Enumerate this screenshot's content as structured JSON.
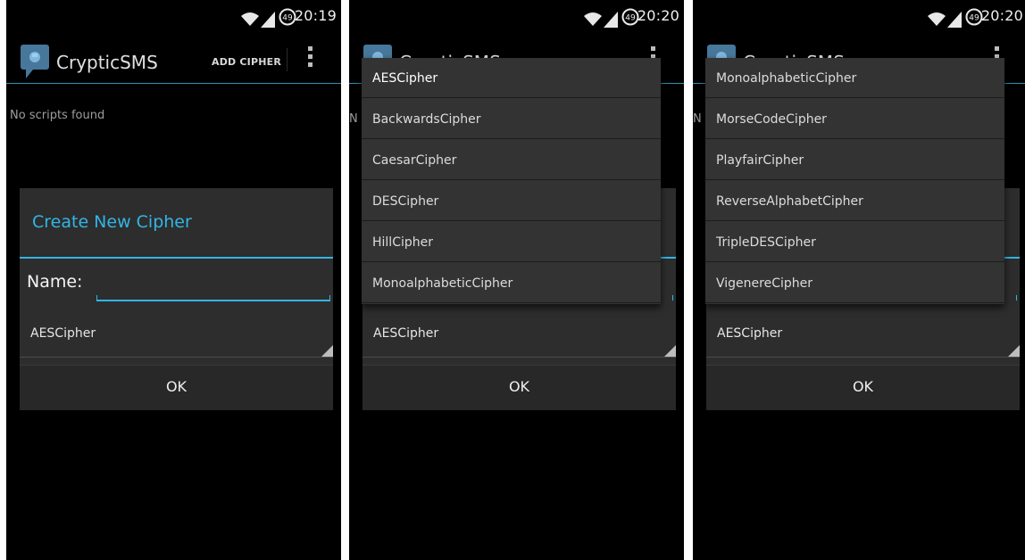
{
  "status_bar": {
    "battery_level": "49",
    "time_left": "20:19",
    "time_middle": "20:20",
    "time_right": "20:20"
  },
  "app": {
    "title": "CrypticSMS",
    "add_cipher_label": "ADD CIPHER",
    "accent": "#33b5e5"
  },
  "main": {
    "empty_message": "No scripts found",
    "empty_peek": "N"
  },
  "dialog": {
    "title": "Create New Cipher",
    "name_label": "Name:",
    "name_value": "",
    "selected_cipher": "AESCipher",
    "ok_label": "OK"
  },
  "dropdown_top": [
    "AESCipher",
    "BackwardsCipher",
    "CaesarCipher",
    "DESCipher",
    "HillCipher",
    "MonoalphabeticCipher"
  ],
  "dropdown_bottom": [
    "MonoalphabeticCipher",
    "MorseCodeCipher",
    "PlayfairCipher",
    "ReverseAlphabetCipher",
    "TripleDESCipher",
    "VigenereCipher"
  ]
}
